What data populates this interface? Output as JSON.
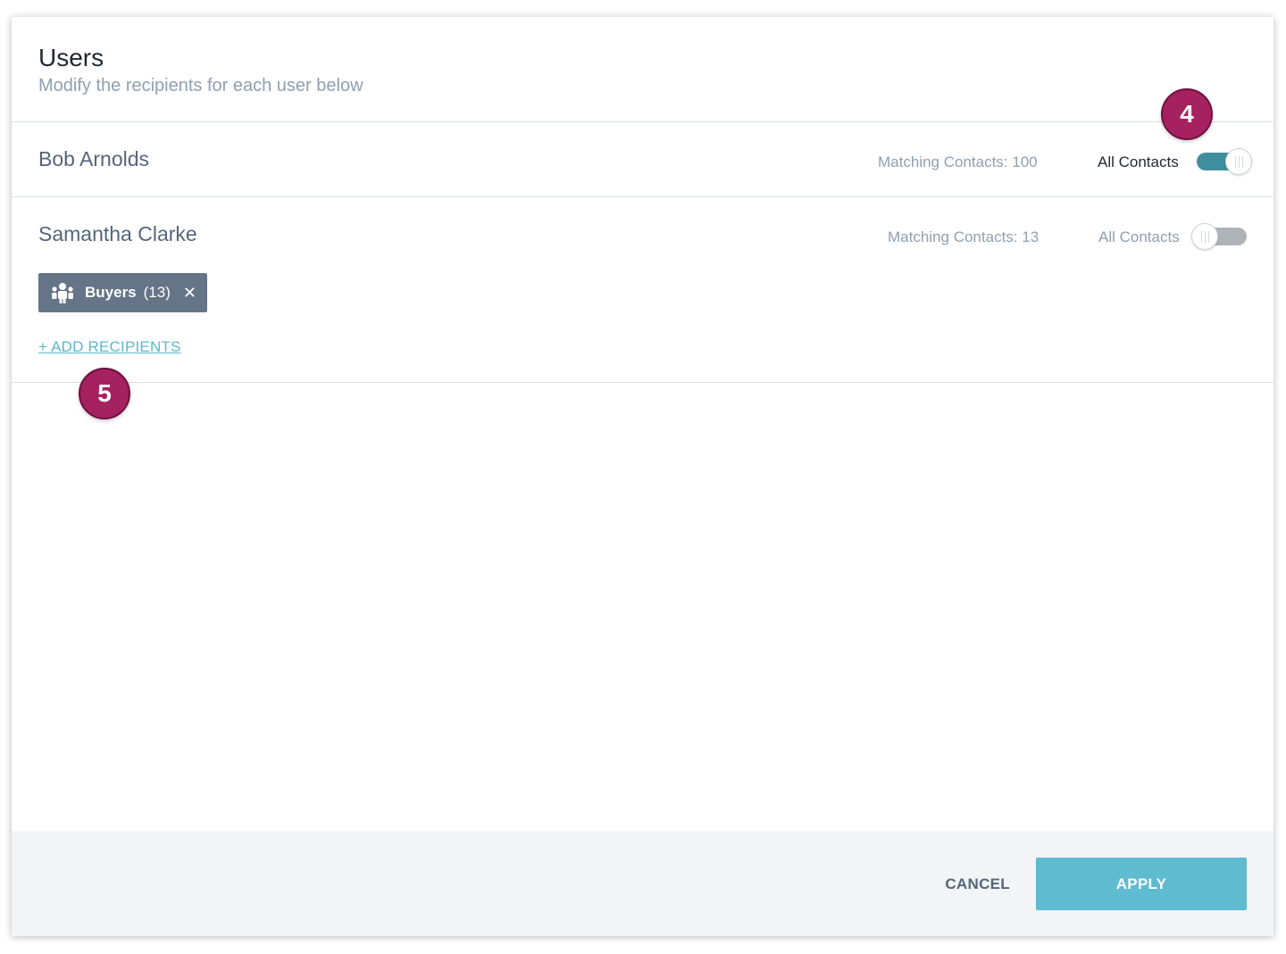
{
  "header": {
    "title": "Users",
    "subtitle": "Modify the recipients for each user below"
  },
  "users": [
    {
      "name": "Bob Arnolds",
      "matching": "Matching Contacts: 100",
      "all_contacts_label": "All Contacts",
      "all_contacts_on": true
    },
    {
      "name": "Samantha Clarke",
      "matching": "Matching Contacts: 13",
      "all_contacts_label": "All Contacts",
      "all_contacts_on": false,
      "chips": [
        {
          "icon": "people-icon",
          "name": "Buyers",
          "count": "(13)"
        }
      ],
      "add_recipients": "+ ADD RECIPIENTS"
    }
  ],
  "callouts": [
    "4",
    "5"
  ],
  "footer": {
    "cancel_label": "CANCEL",
    "apply_label": "APPLY"
  },
  "colors": {
    "toggle_on": "#3f8e9e",
    "toggle_off": "#aeb3b8",
    "accent": "#5fbbd0",
    "chip": "#657487",
    "badge": "#a6215f"
  }
}
